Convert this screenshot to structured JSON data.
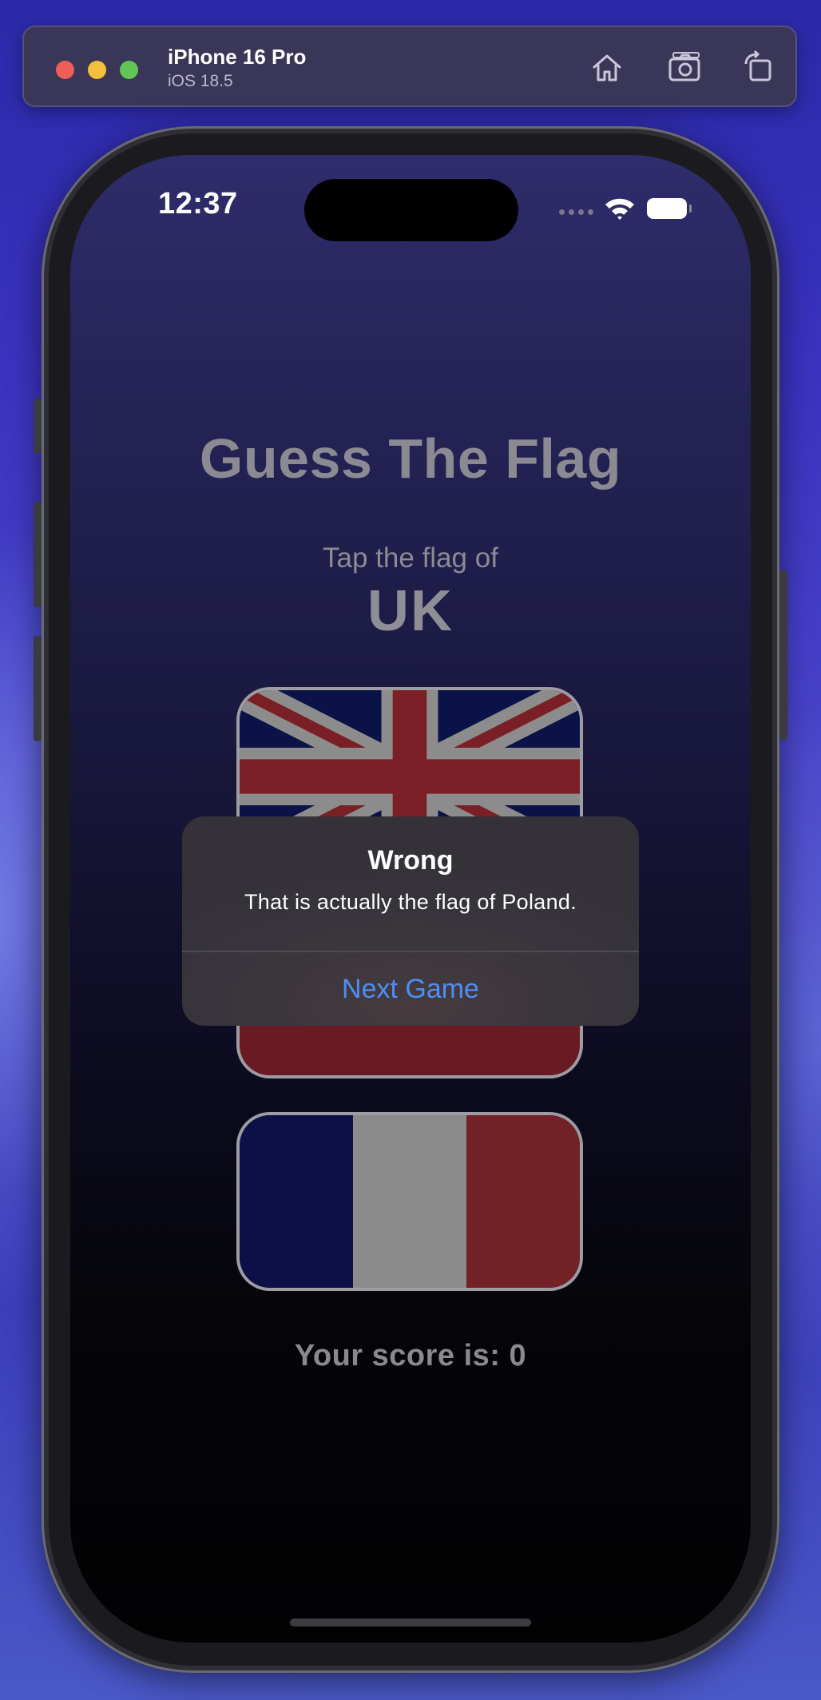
{
  "simulator": {
    "device_name": "iPhone 16 Pro",
    "os_version": "iOS 18.5",
    "toolbar_icons": [
      "home-icon",
      "screenshot-icon",
      "rotate-icon"
    ]
  },
  "status_bar": {
    "time": "12:37"
  },
  "app": {
    "title": "Guess The Flag",
    "prompt": "Tap the flag of",
    "country": "UK",
    "flags": [
      "uk",
      "poland",
      "france"
    ],
    "score_text": "Your score is: 0"
  },
  "alert": {
    "title": "Wrong",
    "message": "That is actually the flag of Poland.",
    "action": "Next Game"
  },
  "colors": {
    "accent": "#4f8ef5",
    "background_top": "#2f2c6c",
    "background_bottom": "#020203"
  }
}
